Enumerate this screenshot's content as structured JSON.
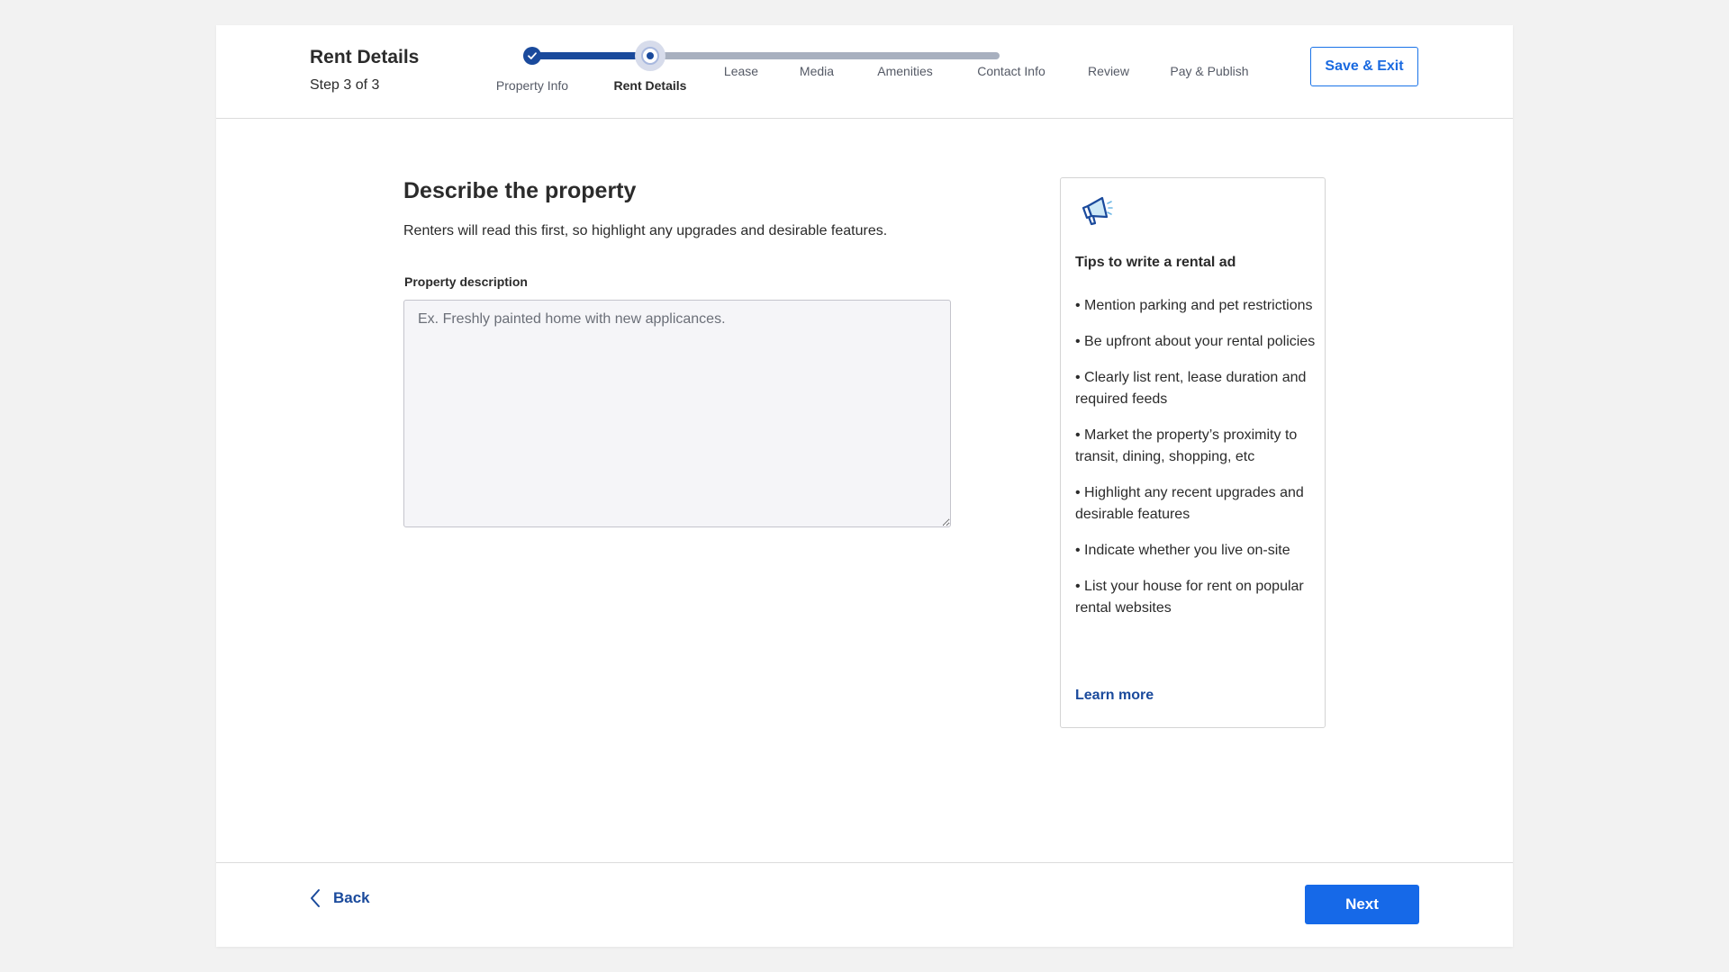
{
  "header": {
    "title": "Rent Details",
    "step": "Step 3 of 3",
    "save_exit_label": "Save & Exit",
    "progress_fraction": 0.25,
    "steps": [
      {
        "label": "Property Info",
        "state": "done"
      },
      {
        "label": "Rent Details",
        "state": "current"
      },
      {
        "label": "Lease",
        "state": "upcoming"
      },
      {
        "label": "Media",
        "state": "upcoming"
      },
      {
        "label": "Amenities",
        "state": "upcoming"
      },
      {
        "label": "Contact Info",
        "state": "upcoming"
      },
      {
        "label": "Review",
        "state": "upcoming"
      },
      {
        "label": "Pay & Publish",
        "state": "upcoming"
      }
    ]
  },
  "main": {
    "title": "Describe the property",
    "subtitle": "Renters will read this first, so highlight any upgrades and desirable features.",
    "field_label": "Property description",
    "field_placeholder": "Ex. Freshly painted home with new applicances.",
    "field_value": ""
  },
  "tips": {
    "icon": "megaphone-icon",
    "title": "Tips to write a rental ad",
    "items": [
      "• Mention parking and pet restrictions",
      "• Be upfront about your rental policies",
      "• Clearly list rent, lease duration and required feeds",
      "• Market the property’s proximity to transit, dining, shopping, etc",
      "• Highlight any recent upgrades and desirable features",
      "• Indicate whether you live on-site",
      "• List your house for rent on popular rental websites"
    ],
    "learn_more": "Learn more"
  },
  "footer": {
    "back_label": "Back",
    "next_label": "Next"
  },
  "colors": {
    "primary": "#1669e8",
    "navy": "#1a4a9c",
    "track": "#a8b0bf"
  }
}
